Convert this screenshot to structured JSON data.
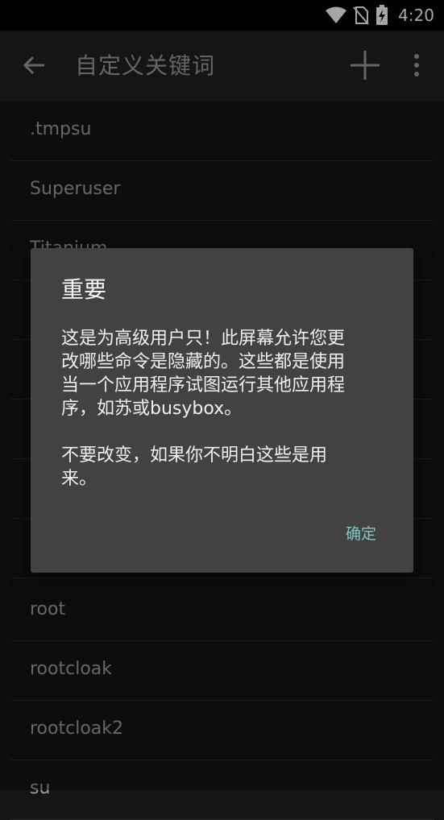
{
  "status_bar": {
    "time": "4:20",
    "icons": [
      "wifi-icon",
      "no-sim-icon",
      "battery-charging-icon"
    ]
  },
  "toolbar": {
    "title": "自定义关键词",
    "back_icon": "arrow-back-icon",
    "add_icon": "add-icon",
    "more_icon": "more-vert-icon"
  },
  "list": {
    "items": [
      {
        "label": ".tmpsu"
      },
      {
        "label": "Superuser"
      },
      {
        "label": "Titanium"
      },
      {
        "label": ""
      },
      {
        "label": ""
      },
      {
        "label": ""
      },
      {
        "label": ""
      },
      {
        "label": ""
      },
      {
        "label": "root"
      },
      {
        "label": "rootcloak"
      },
      {
        "label": "rootcloak2"
      },
      {
        "label": "su"
      }
    ]
  },
  "dialog": {
    "title": "重要",
    "body_lines_1": [
      "这是为高级用户只！此屏幕允许您更",
      "改哪些命令是隐藏的。这些都是使用",
      "当一个应用程序试图运行其他应用程",
      "序，如苏或busybox。"
    ],
    "body_lines_2": [
      "不要改变，如果你不明白这些是用",
      "来。"
    ],
    "ok_button": "确定",
    "accent_color": "#80cbc4"
  }
}
